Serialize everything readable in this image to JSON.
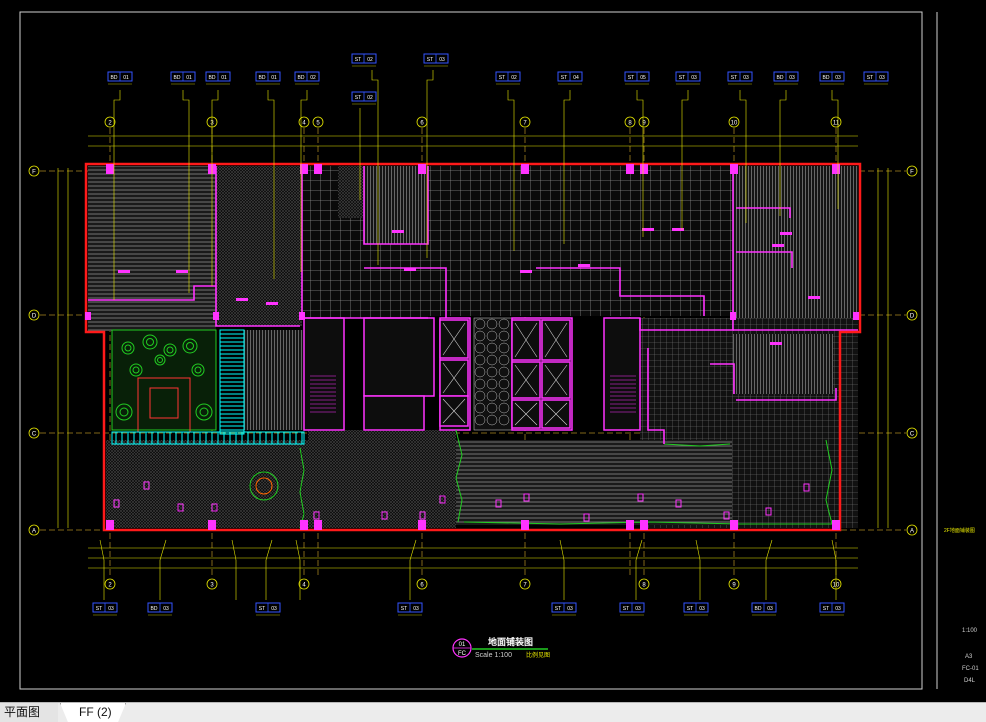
{
  "drawing": {
    "title": "地面铺装图",
    "detail_no": "01",
    "sheet_code": "FC",
    "scale_text": "Scale 1:100",
    "scale_note": "比例见图",
    "side_note": "2F地面铺装图",
    "title_block": {
      "scale": "1:100",
      "size": "A3",
      "sheet": "FC-01",
      "rev": "D4L"
    }
  },
  "grid": {
    "columns_top": [
      "2",
      "3",
      "4",
      "5",
      "6",
      "7",
      "8",
      "9",
      "10",
      "11"
    ],
    "rows_left": [
      "F",
      "D",
      "C",
      "A"
    ],
    "columns_bottom": [
      "2",
      "3",
      "4",
      "6",
      "7",
      "8",
      "9",
      "10"
    ]
  },
  "callouts_top": [
    {
      "a": "BD",
      "b": "01"
    },
    {
      "a": "BD",
      "b": "01"
    },
    {
      "a": "BD",
      "b": "01"
    },
    {
      "a": "BD",
      "b": "01"
    },
    {
      "a": "BD",
      "b": "02"
    },
    {
      "a": "ST",
      "b": "02"
    },
    {
      "a": "ST",
      "b": "03"
    },
    {
      "a": "ST",
      "b": "02"
    },
    {
      "a": "ST",
      "b": "04"
    },
    {
      "a": "ST",
      "b": "05"
    },
    {
      "a": "ST",
      "b": "03"
    },
    {
      "a": "ST",
      "b": "03"
    },
    {
      "a": "BD",
      "b": "03"
    },
    {
      "a": "BD",
      "b": "03"
    }
  ],
  "callouts_bottom": [
    {
      "a": "ST",
      "b": "03"
    },
    {
      "a": "BD",
      "b": "03"
    },
    {
      "a": "ST",
      "b": "03"
    },
    {
      "a": "ST",
      "b": "03"
    },
    {
      "a": "ST",
      "b": "03"
    },
    {
      "a": "ST",
      "b": "03"
    },
    {
      "a": "ST",
      "b": "03"
    },
    {
      "a": "BD",
      "b": "03"
    },
    {
      "a": "ST",
      "b": "03"
    }
  ],
  "tabs": [
    {
      "label": "平面图"
    },
    {
      "label": "FF (2)"
    }
  ],
  "colors": {
    "background": "#000000",
    "outline": "#ff1a1a",
    "wall": "#ff33ff",
    "dimension": "#e8e800",
    "grid_line": "#ffcc33",
    "landscape": "#22cc22",
    "stair": "#00ffff",
    "hatch": "#9a9a9a",
    "callout": "#3355ff"
  }
}
